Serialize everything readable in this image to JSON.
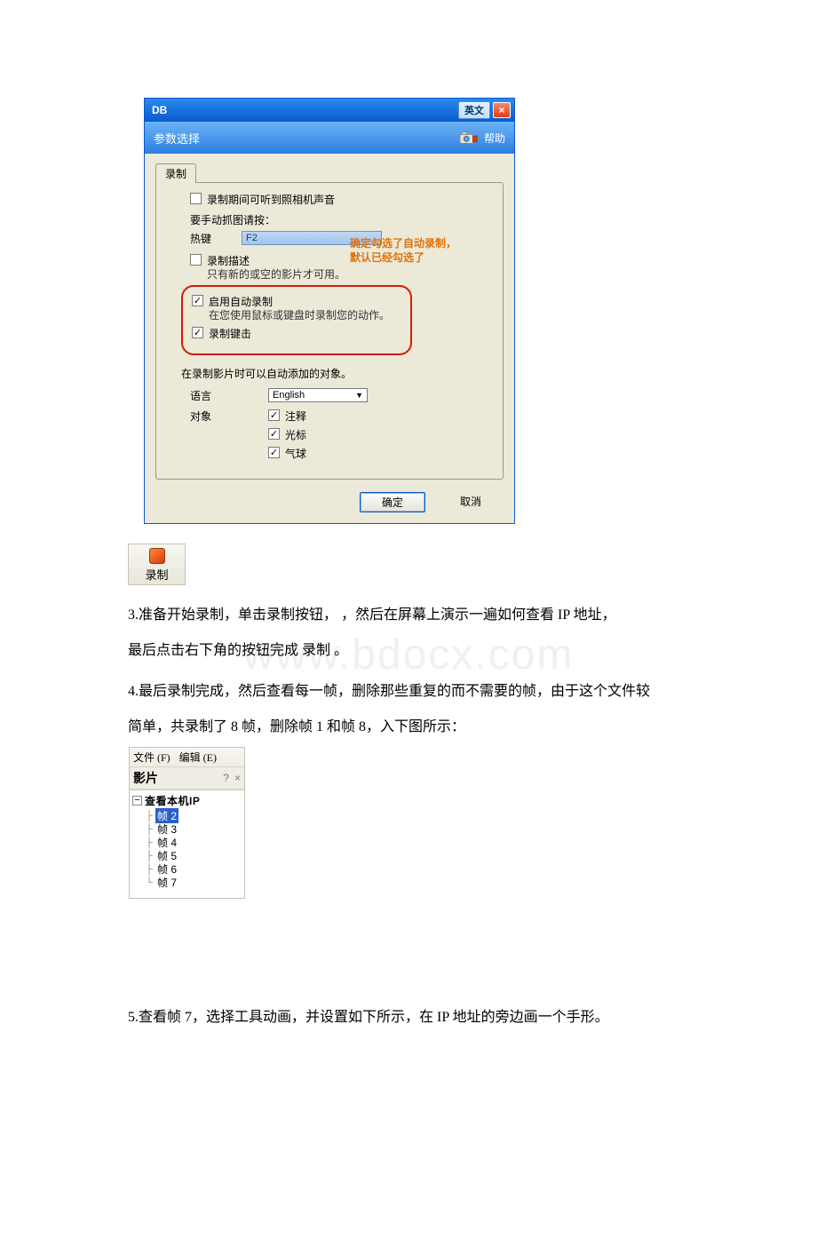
{
  "watermark": "www.bdocx.com",
  "dialog": {
    "title": "DB",
    "lang_button": "英文",
    "close_symbol": "×",
    "subhead_label": "参数选择",
    "help_label": "帮助",
    "tab_label": "录制",
    "camera_sound_label": "录制期间可听到照相机声音",
    "manual_capture_label": "要手动抓图请按：",
    "hotkey_label": "热键",
    "hotkey_value": "F2",
    "callout_line1": "确定勾选了自动录制，",
    "callout_line2": "默认已经勾选了",
    "record_desc_label": "录制描述",
    "record_desc_note": "只有新的或空的影片才可用。",
    "auto_record_label": "启用自动录制",
    "auto_record_note": "在您使用鼠标或键盘时录制您的动作。",
    "record_keys_label": "录制键击",
    "auto_add_objects_label": "在录制影片时可以自动添加的对象。",
    "language_label": "语言",
    "language_value": "English",
    "object_label": "对象",
    "obj_annotation": "注释",
    "obj_cursor": "光标",
    "obj_balloon": "气球",
    "ok_label": "确定",
    "cancel_label": "取消"
  },
  "record_button_label": "录制",
  "para3": "3.准备开始录制，单击录制按钮， ，然后在屏幕上演示一遍如何查看 IP 地址，",
  "para3b": "最后点击右下角的按钮完成 录制 。",
  "para4": "4.最后录制完成，然后查看每一帧，删除那些重复的而不需要的帧，由于这个文件较",
  "para4b": "简单，共录制了 8 帧，删除帧 1 和帧 8，入下图所示：",
  "frames": {
    "menu_file": "文件 (F)",
    "menu_edit": "编辑 (E)",
    "panel_title": "影片",
    "help_symbol": "?",
    "close_symbol": "×",
    "root_label": "查看本机IP",
    "minus": "−",
    "items": [
      {
        "label": "帧 2",
        "selected": true
      },
      {
        "label": "帧 3",
        "selected": false
      },
      {
        "label": "帧 4",
        "selected": false
      },
      {
        "label": "帧 5",
        "selected": false
      },
      {
        "label": "帧 6",
        "selected": false
      },
      {
        "label": "帧 7",
        "selected": false
      }
    ]
  },
  "para5": "5.查看帧 7，选择工具动画，并设置如下所示，在 IP 地址的旁边画一个手形。"
}
